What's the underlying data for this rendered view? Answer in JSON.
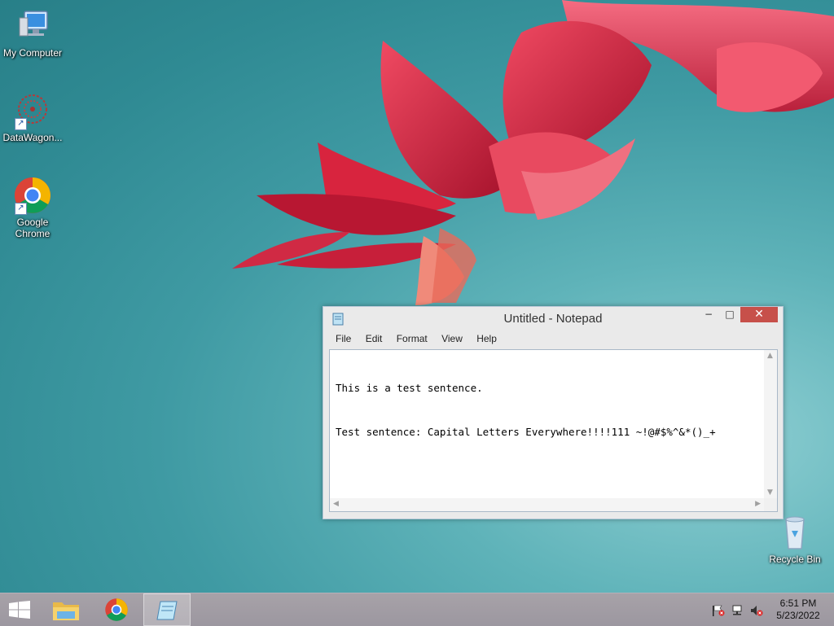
{
  "desktop": {
    "icons": [
      {
        "label": "My Computer",
        "icon": "computer-icon"
      },
      {
        "label": "DataWagon...",
        "icon": "datawagon-icon"
      },
      {
        "label": "Google Chrome",
        "icon": "chrome-icon"
      },
      {
        "label": "Recycle Bin",
        "icon": "recycle-bin-icon"
      }
    ]
  },
  "notepad": {
    "title": "Untitled - Notepad",
    "controls": {
      "minimize": "−",
      "maximize": "□",
      "close": "✕"
    },
    "menu": [
      "File",
      "Edit",
      "Format",
      "View",
      "Help"
    ],
    "content_lines": [
      "This is a test sentence.",
      "Test sentence: Capital Letters Everywhere!!!!111 ~!@#$%^&*()_+"
    ]
  },
  "taskbar": {
    "items": [
      {
        "name": "start-button",
        "icon": "windows-logo-icon"
      },
      {
        "name": "file-explorer",
        "icon": "folder-icon"
      },
      {
        "name": "chrome",
        "icon": "chrome-icon"
      },
      {
        "name": "notepad",
        "icon": "notepad-icon",
        "active": true
      }
    ],
    "tray": [
      "flag-icon",
      "network-icon",
      "volume-muted-icon"
    ],
    "clock": {
      "time": "6:51 PM",
      "date": "5/23/2022"
    }
  },
  "colors": {
    "wallpaper_teal": "#3f9aa3",
    "flower_red": "#e0203a",
    "close_button": "#c7504a",
    "taskbar": "#a29da5"
  }
}
